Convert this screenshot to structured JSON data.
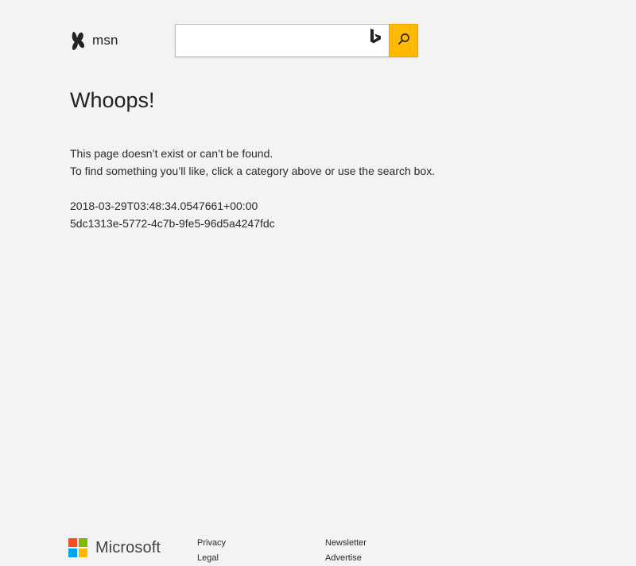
{
  "header": {
    "logo_text": "msn",
    "search": {
      "value": "",
      "placeholder": ""
    },
    "bing_icon": "bing-logo-icon",
    "search_icon": "search-icon"
  },
  "main": {
    "title": "Whoops!",
    "message_lines": [
      "This page doesn’t exist or can’t be found.",
      "To find something you’ll like, click a category above or use the search box."
    ],
    "timestamp": "2018-03-29T03:48:34.0547661+00:00",
    "request_id": "5dc1313e-5772-4c7b-9fe5-96d5a4247fdc"
  },
  "footer": {
    "brand": "Microsoft",
    "columns": [
      [
        "Privacy",
        "Legal"
      ],
      [
        "Newsletter",
        "Advertise"
      ]
    ]
  },
  "colors": {
    "background": "#f3f3f2",
    "search_button": "#ffb900",
    "ms_red": "#f25022",
    "ms_green": "#7fba00",
    "ms_blue": "#00a4ef",
    "ms_yellow": "#ffb900"
  }
}
